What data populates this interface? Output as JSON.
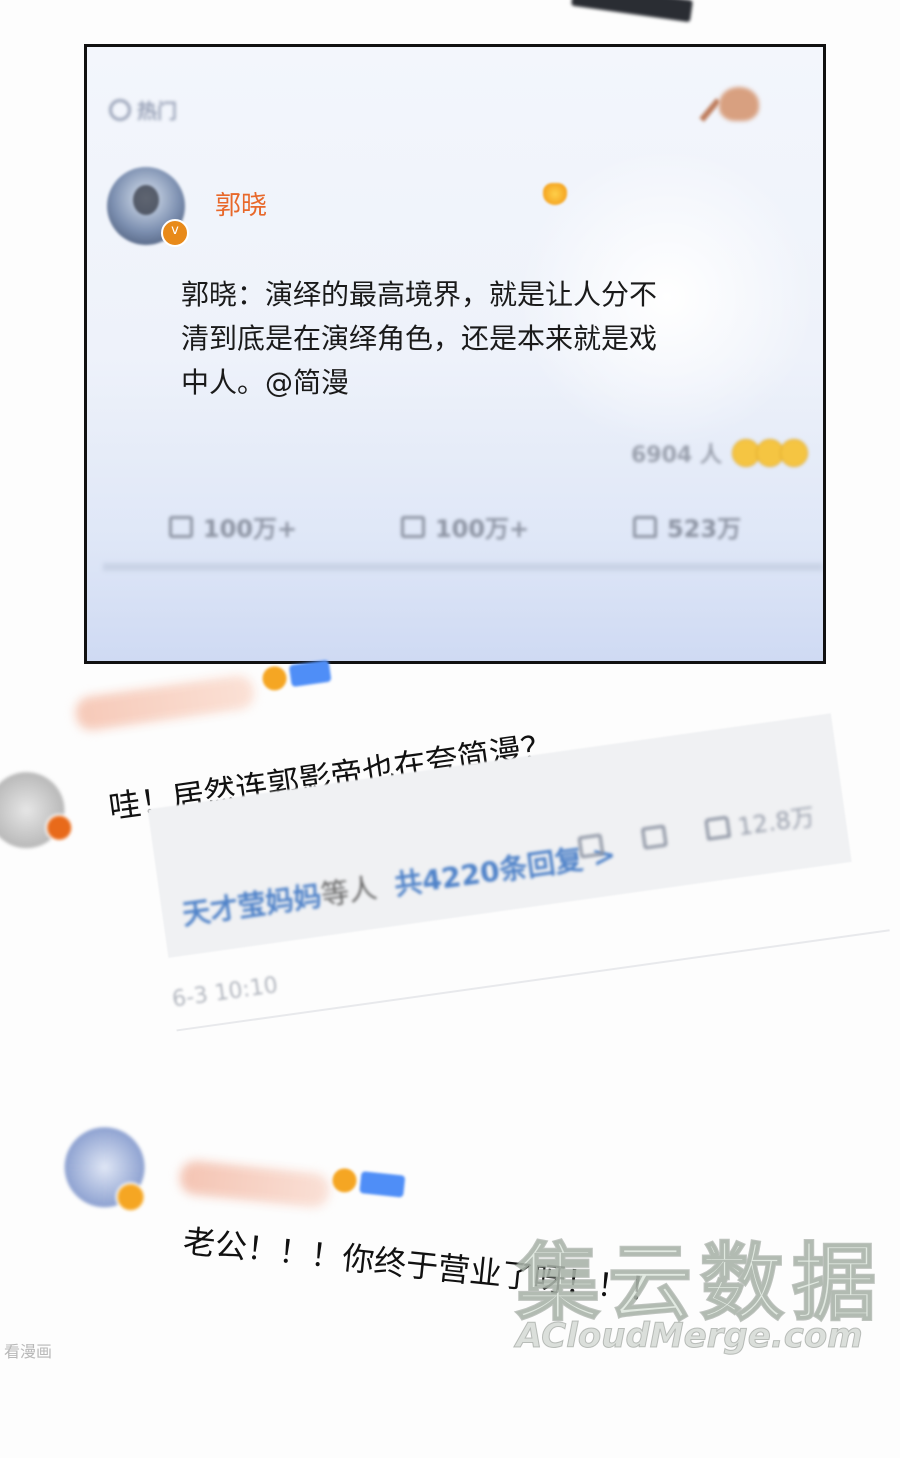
{
  "panel": {
    "hot_tab_label": "热门",
    "author": "郭晓",
    "post_text": "郭晓：演绎的最高境界，就是让人分不清到底是在演绎角色，还是本来就是戏中人。@简漫",
    "reaction_count": "6904 人",
    "actions": {
      "repost": "100万+",
      "comment": "100万+",
      "like": "523万"
    }
  },
  "comment1": {
    "text": "哇！居然连郭影帝也在夸简漫？",
    "reply_names": "天才莹妈妈",
    "reply_others": "等人",
    "reply_count": "共4220条回复 >",
    "likes": "12.8万",
    "time": "6-3 10:10"
  },
  "comment2": {
    "text": "老公！！！你终于营业了呀！！！"
  },
  "watermark": {
    "big": "集云数据",
    "small": "ACloudMerge.com",
    "corner": "看漫画"
  }
}
